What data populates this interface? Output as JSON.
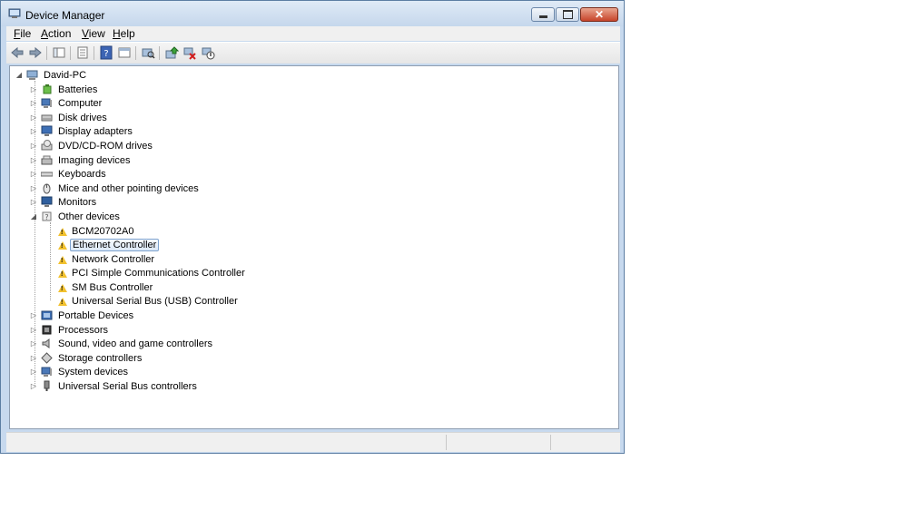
{
  "window": {
    "title": "Device Manager"
  },
  "menu": [
    {
      "label": "File"
    },
    {
      "label": "Action"
    },
    {
      "label": "View"
    },
    {
      "label": "Help"
    }
  ],
  "toolbar_icons": [
    "back-arrow-icon",
    "forward-arrow-icon",
    "console-tree-icon",
    "properties-icon",
    "help-icon",
    "show-hide-icon",
    "scan-hardware-icon",
    "update-driver-icon",
    "uninstall-icon",
    "disable-icon"
  ],
  "tree": {
    "root": "David-PC",
    "categories": [
      {
        "label": "Batteries",
        "icon": "battery-icon"
      },
      {
        "label": "Computer",
        "icon": "computer-icon"
      },
      {
        "label": "Disk drives",
        "icon": "disk-drive-icon"
      },
      {
        "label": "Display adapters",
        "icon": "display-adapter-icon"
      },
      {
        "label": "DVD/CD-ROM drives",
        "icon": "dvd-drive-icon"
      },
      {
        "label": "Imaging devices",
        "icon": "imaging-device-icon"
      },
      {
        "label": "Keyboards",
        "icon": "keyboard-icon"
      },
      {
        "label": "Mice and other pointing devices",
        "icon": "mouse-icon"
      },
      {
        "label": "Monitors",
        "icon": "monitor-icon"
      },
      {
        "label": "Other devices",
        "icon": "other-devices-icon",
        "expanded": true,
        "children": [
          {
            "label": "BCM20702A0"
          },
          {
            "label": "Ethernet Controller",
            "selected": true
          },
          {
            "label": "Network Controller"
          },
          {
            "label": "PCI Simple Communications Controller"
          },
          {
            "label": "SM Bus Controller"
          },
          {
            "label": "Universal Serial Bus (USB) Controller"
          }
        ]
      },
      {
        "label": "Portable Devices",
        "icon": "portable-device-icon"
      },
      {
        "label": "Processors",
        "icon": "processor-icon"
      },
      {
        "label": "Sound, video and game controllers",
        "icon": "speaker-icon"
      },
      {
        "label": "Storage controllers",
        "icon": "storage-controller-icon"
      },
      {
        "label": "System devices",
        "icon": "system-device-icon"
      },
      {
        "label": "Universal Serial Bus controllers",
        "icon": "usb-icon"
      }
    ]
  },
  "colors": {
    "selection_border": "#7da2ce",
    "warning": "#f2c12e",
    "window_frame": "#c7d9ee"
  }
}
